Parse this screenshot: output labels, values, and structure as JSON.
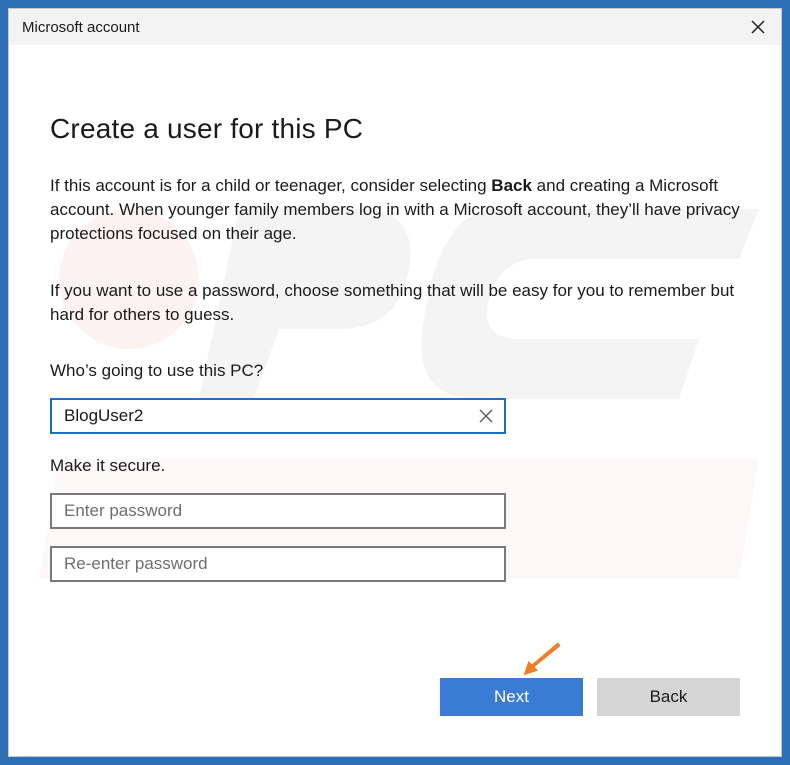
{
  "window": {
    "title": "Microsoft account"
  },
  "page": {
    "heading": "Create a user for this PC",
    "para1_before_bold": "If this account is for a child or teenager, consider selecting ",
    "para1_bold": "Back",
    "para1_after_bold": " and creating a Microsoft account. When younger family members log in with a Microsoft account, they’ll have privacy protections focused on their age.",
    "para2": "If you want to use a password, choose something that will be easy for you to remember but hard for others to guess."
  },
  "form": {
    "user_label": "Who’s going to use this PC?",
    "user_value": "BlogUser2",
    "secure_label": "Make it secure.",
    "password_placeholder": "Enter password",
    "password_value": "",
    "repassword_placeholder": "Re-enter password",
    "repassword_value": ""
  },
  "buttons": {
    "next_label": "Next",
    "back_label": "Back"
  },
  "icons": {
    "close": "close-icon",
    "clear": "clear-icon",
    "pointer": "arrow-pointer-icon"
  },
  "colors": {
    "accent": "#3a7bd5",
    "focus_border": "#1e6fc6",
    "pointer_arrow": "#f07f2a",
    "window_border_bg": "#2d6fb5"
  }
}
